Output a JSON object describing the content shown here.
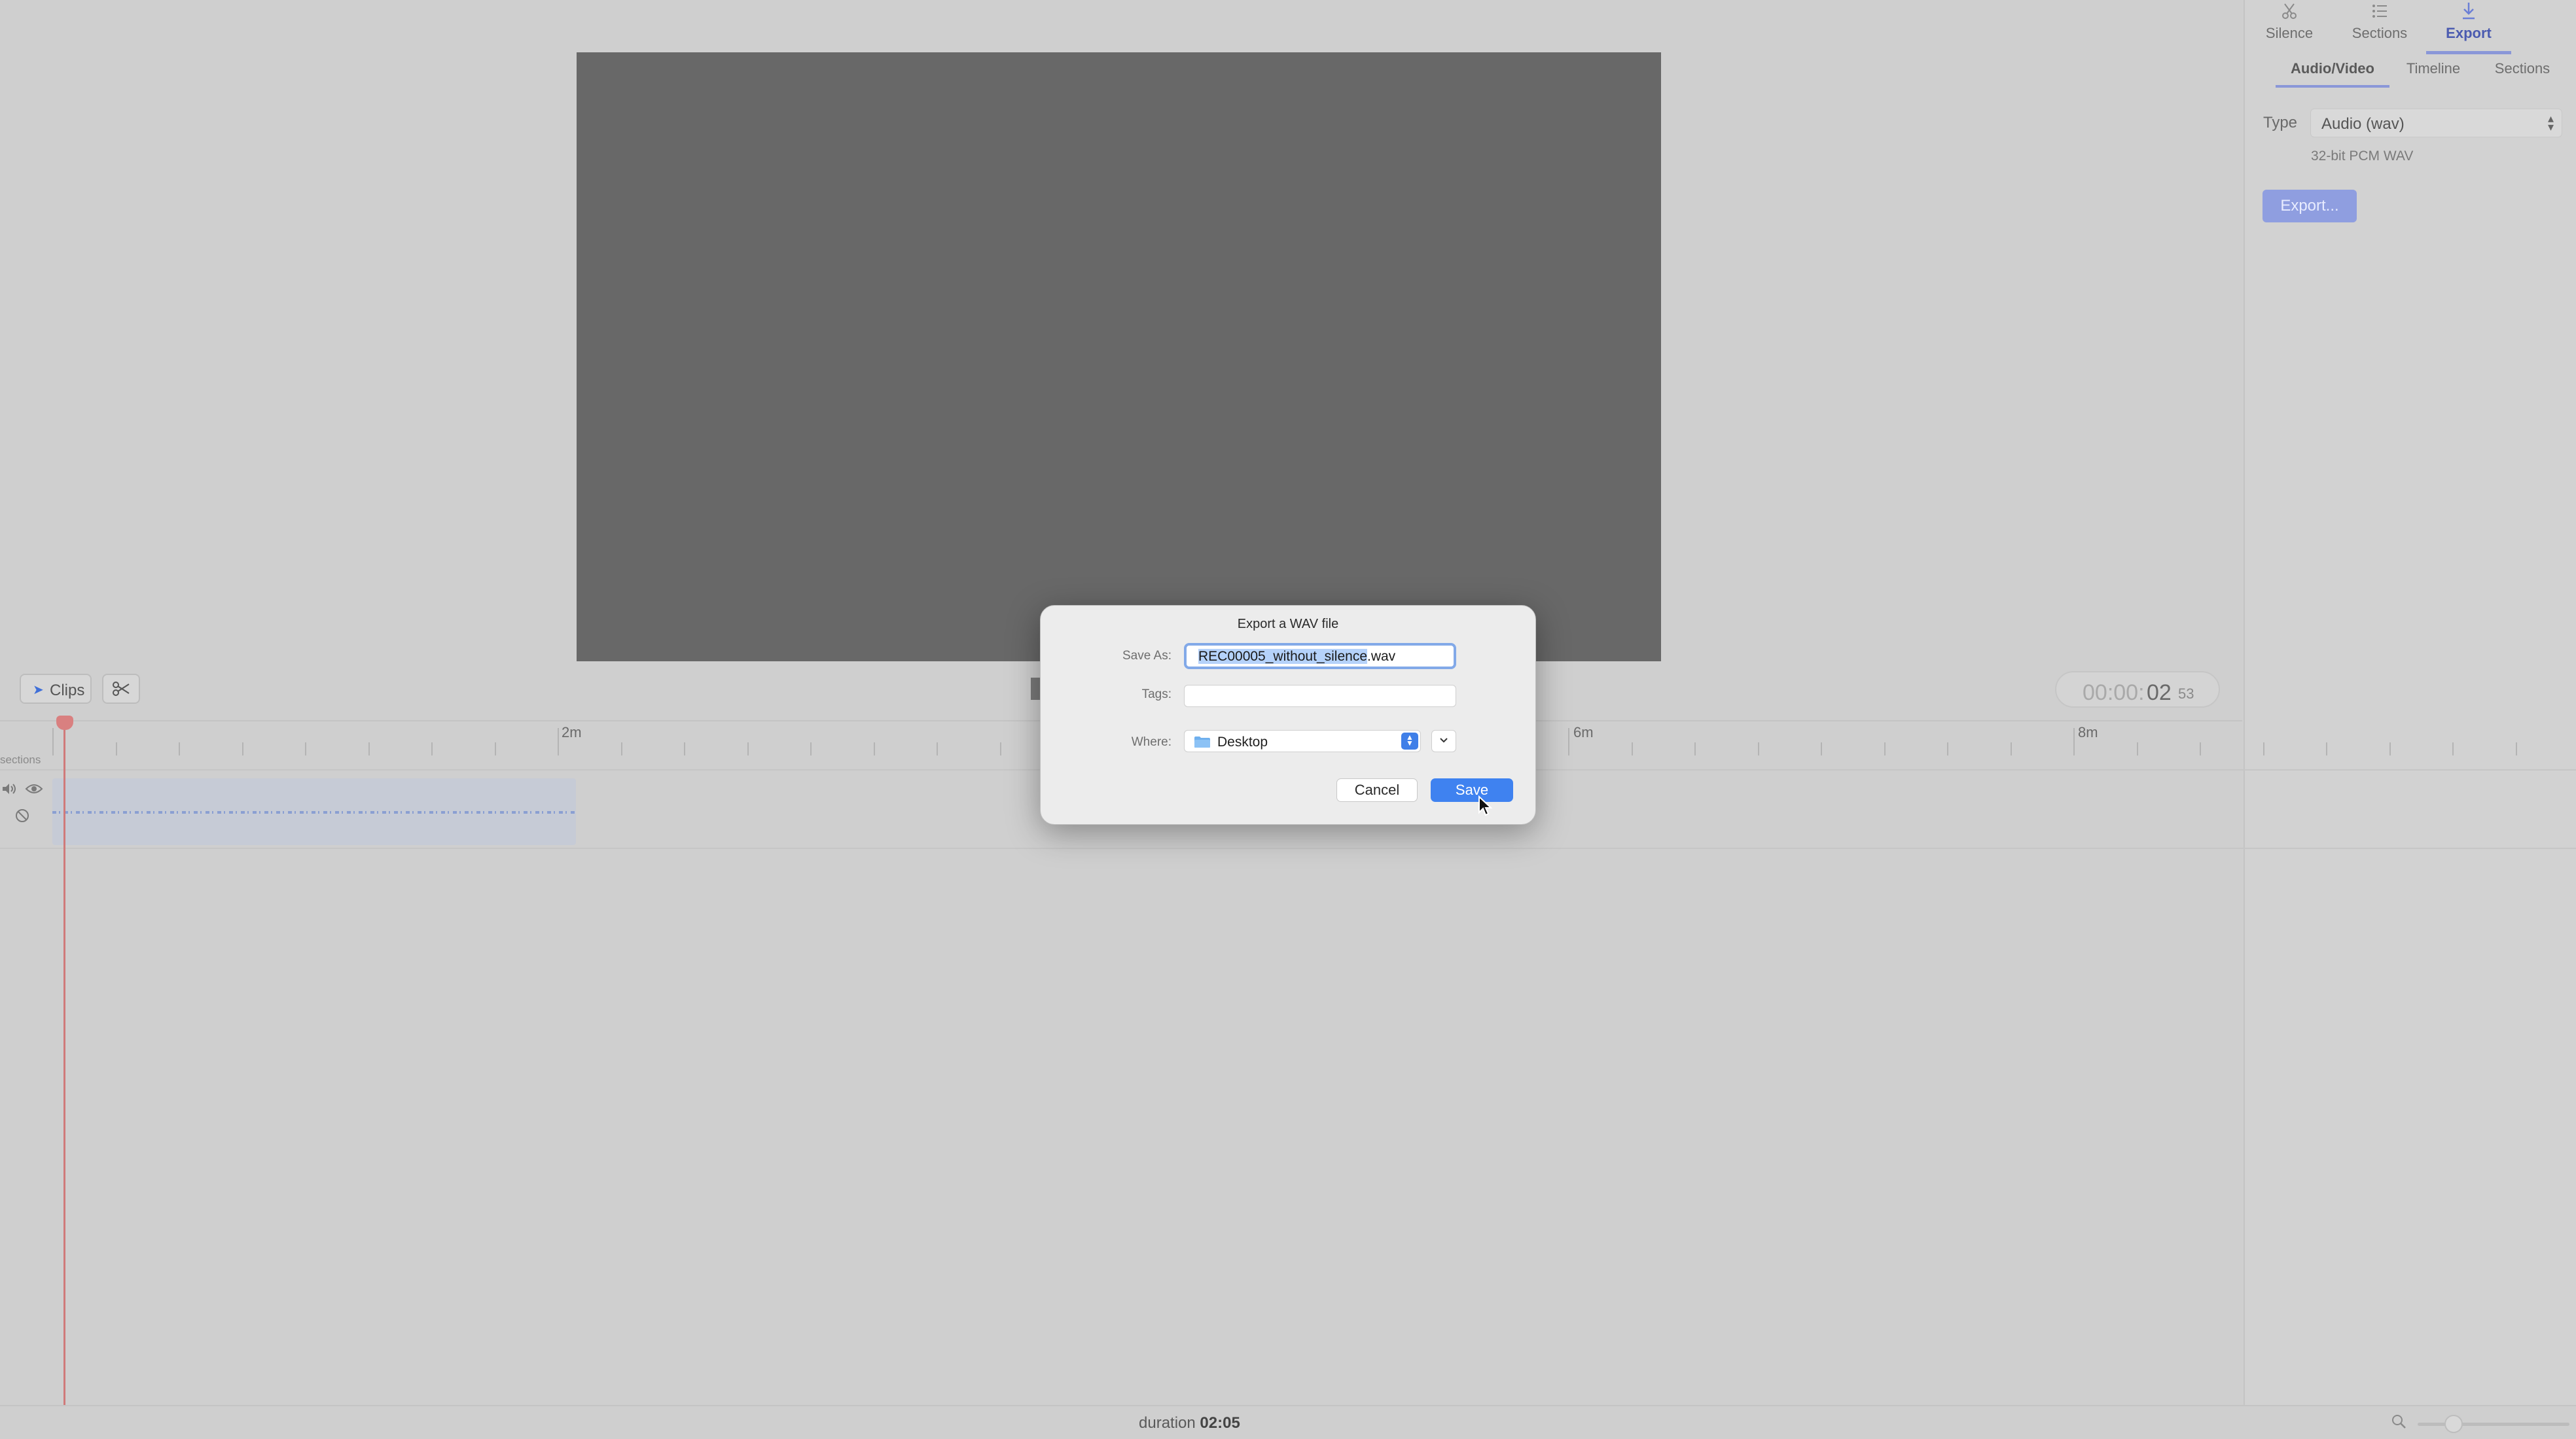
{
  "inspector": {
    "top_tabs": [
      {
        "label": "Silence",
        "icon": "scissors-icon"
      },
      {
        "label": "Sections",
        "icon": "list-icon"
      },
      {
        "label": "Export",
        "icon": "download-icon",
        "active": true
      }
    ],
    "sub_tabs": [
      {
        "label": "Audio/Video",
        "active": true
      },
      {
        "label": "Timeline"
      },
      {
        "label": "Sections"
      }
    ],
    "type_label": "Type",
    "type_value": "Audio (wav)",
    "type_description": "32-bit PCM WAV",
    "export_button": "Export..."
  },
  "toolbar": {
    "clips_label": "Clips",
    "timecode_dim": "00:00:",
    "timecode_main": "02",
    "timecode_frames": "53"
  },
  "timeline": {
    "ruler_labels": [
      "2m",
      "6m",
      "8m"
    ],
    "sections_label": "sections",
    "playhead_color": "#d98080"
  },
  "status": {
    "duration_label": "duration",
    "duration_value": "02:05"
  },
  "dialog": {
    "title": "Export a WAV file",
    "save_as_label": "Save As:",
    "filename_selected": "REC00005_without_silence",
    "filename_ext": ".wav",
    "tags_label": "Tags:",
    "where_label": "Where:",
    "where_value": "Desktop",
    "cancel_label": "Cancel",
    "save_label": "Save",
    "accent_color": "#3f82f0"
  }
}
